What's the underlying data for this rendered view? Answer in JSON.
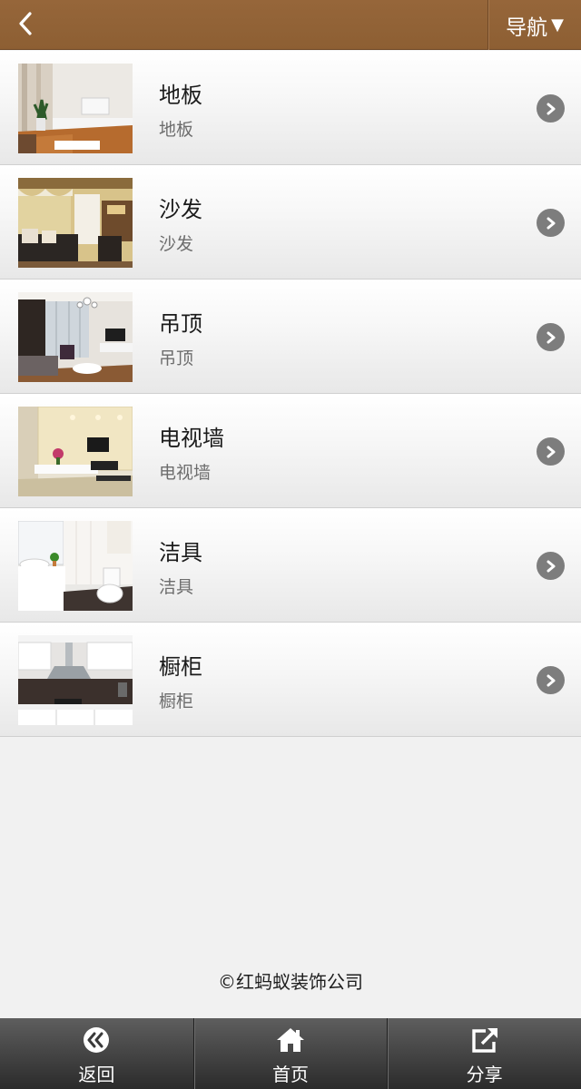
{
  "header": {
    "back_icon": "chevron-left-icon",
    "nav_label": "导航",
    "nav_caret": "▼"
  },
  "list": {
    "items": [
      {
        "title": "地板",
        "subtitle": "地板",
        "thumbnail": "living-room-floor-photo"
      },
      {
        "title": "沙发",
        "subtitle": "沙发",
        "thumbnail": "sofa-living-room-photo"
      },
      {
        "title": "吊顶",
        "subtitle": "吊顶",
        "thumbnail": "ceiling-living-room-photo"
      },
      {
        "title": "电视墙",
        "subtitle": "电视墙",
        "thumbnail": "tv-wall-photo"
      },
      {
        "title": "洁具",
        "subtitle": "洁具",
        "thumbnail": "bathroom-fixtures-photo"
      },
      {
        "title": "橱柜",
        "subtitle": "橱柜",
        "thumbnail": "kitchen-cabinet-photo"
      }
    ]
  },
  "footer": {
    "copyright": "©红蚂蚁装饰公司"
  },
  "bottom_bar": {
    "back_label": "返回",
    "home_label": "首页",
    "share_label": "分享"
  },
  "colors": {
    "header_brown": "#8f6134",
    "chevron_gray": "#7d7d7d",
    "bottom_bar_dark": "#3a3a3a"
  }
}
